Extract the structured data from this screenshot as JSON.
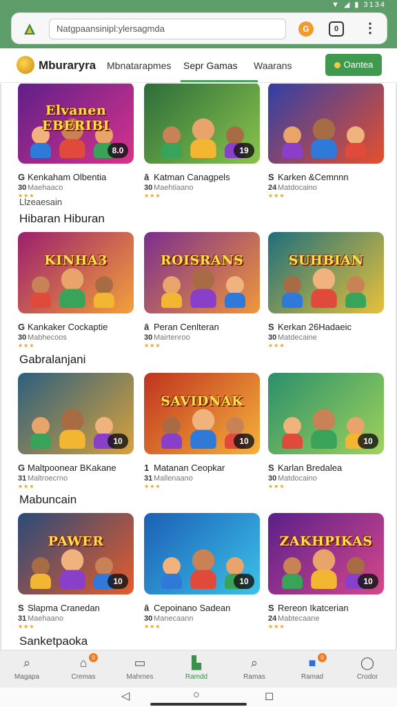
{
  "status_bar": {
    "icons": "▼ ◢ ▮ 3134"
  },
  "browser": {
    "url_text": "Natgpaansinipl:ylersagmda",
    "ext_icon": "G",
    "tabs_count": "0",
    "menu_glyph": "⋮"
  },
  "site": {
    "brand": "Mburaryra",
    "nav": [
      "Mbnatarapmes",
      "Sepr Gamas",
      "Waarans"
    ],
    "cta": "Oantea",
    "accent": "#3f9a4f"
  },
  "sections": [
    {
      "title": "",
      "sub": "",
      "cards": [
        {
          "art": "Elvanen EBERIBI",
          "badge": "8.0",
          "title": "Kenkaham Olbentia",
          "meta": "Maehaaco",
          "icon": "G",
          "num": "30",
          "colors": [
            "#5e1f8a",
            "#d8338b"
          ]
        },
        {
          "art": "",
          "badge": "19",
          "title": "Katman Canagpels",
          "meta": "Maehtiaano",
          "icon": "ā",
          "num": "30",
          "colors": [
            "#2c6d3a",
            "#8ac44c"
          ]
        },
        {
          "art": "",
          "badge": "",
          "title": "Karken &Cemnnn",
          "meta": "Matdocaino",
          "icon": "S",
          "num": "24",
          "colors": [
            "#2f3fa8",
            "#e6502d"
          ]
        }
      ]
    },
    {
      "title": "Hibaran Hiburan",
      "sub": "Llzeaesain",
      "cards": [
        {
          "art": "KINHA3",
          "badge": "",
          "title": "Kankaker Cockaptie",
          "meta": "Mabhecoos",
          "icon": "G",
          "num": "30",
          "colors": [
            "#9b1f6e",
            "#f3a13a"
          ]
        },
        {
          "art": "ROISRANS",
          "badge": "",
          "title": "Peran Cenlteran",
          "meta": "Mairtenroo",
          "icon": "ā",
          "num": "30",
          "colors": [
            "#7b2e8e",
            "#f0973a"
          ]
        },
        {
          "art": "SUHBIAN",
          "badge": "",
          "title": "Kerkan 26Hadaeic",
          "meta": "Matdecaine",
          "icon": "S",
          "num": "30",
          "colors": [
            "#1e6f7b",
            "#e8c13a"
          ]
        }
      ]
    },
    {
      "title": "Gabralanjani",
      "sub": "",
      "cards": [
        {
          "art": "",
          "badge": "10",
          "title": "Maltpoonear BKakane",
          "meta": "Maltroecrno",
          "icon": "G",
          "num": "31",
          "colors": [
            "#2c5f7e",
            "#d9a23c"
          ]
        },
        {
          "art": "SAVIDNAK",
          "badge": "10",
          "title": "Matanan Ceopkar",
          "meta": "Mallenaano",
          "icon": "1",
          "num": "31",
          "colors": [
            "#c0331f",
            "#f5b23b"
          ]
        },
        {
          "art": "",
          "badge": "10",
          "title": "Karlan Bredalea",
          "meta": "Matdocaino",
          "icon": "S",
          "num": "30",
          "colors": [
            "#2b8f6b",
            "#9fd35a"
          ]
        }
      ]
    },
    {
      "title": "Mabuncain",
      "sub": "",
      "cards": [
        {
          "art": "PAWER",
          "badge": "10",
          "title": "Slapma Cranedan",
          "meta": "Maehaano",
          "icon": "S",
          "num": "31",
          "colors": [
            "#2a4a7a",
            "#e65c2b"
          ]
        },
        {
          "art": "",
          "badge": "10",
          "title": "Cepoinano Sadean",
          "meta": "Manecaann",
          "icon": "ā",
          "num": "30",
          "colors": [
            "#1b5fb5",
            "#3cc2e8"
          ]
        },
        {
          "art": "ZAKHPIKAS",
          "badge": "10",
          "title": "Rereon Ikatcerian",
          "meta": "Mabtecaane",
          "icon": "S",
          "num": "24",
          "colors": [
            "#5a1f8a",
            "#d6488a"
          ]
        }
      ]
    },
    {
      "title": "Sanketpaoka",
      "sub": "",
      "cards": []
    }
  ],
  "stars": "★★★",
  "tabs": [
    {
      "label": "Magapa",
      "icon": "⌕",
      "badge": ""
    },
    {
      "label": "Cremas",
      "icon": "⌂",
      "badge": "0"
    },
    {
      "label": "Mahrnes",
      "icon": "▭",
      "badge": ""
    },
    {
      "label": "Ramdd",
      "icon": "▙",
      "badge": "",
      "active": true
    },
    {
      "label": "Ramas",
      "icon": "⌕",
      "badge": ""
    },
    {
      "label": "Ramad",
      "icon": "■",
      "badge": "0"
    },
    {
      "label": "Crodor",
      "icon": "◯",
      "badge": ""
    }
  ],
  "sys_nav": [
    "◁",
    "○",
    "◻"
  ]
}
